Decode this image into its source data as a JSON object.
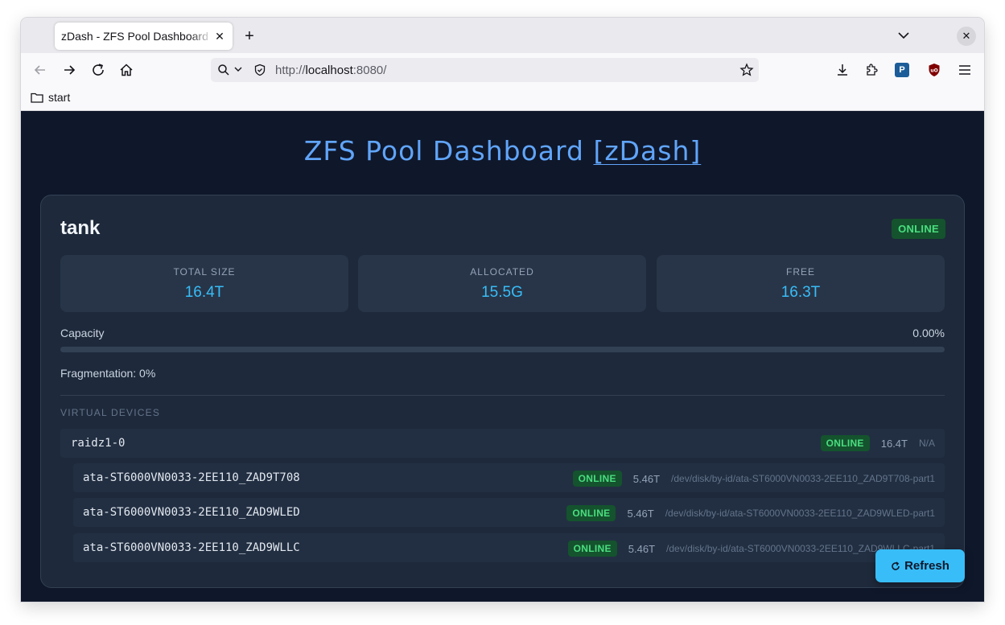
{
  "browser": {
    "tab_title": "zDash - ZFS Pool Dashboard",
    "url_scheme": "http://",
    "url_host": "localhost",
    "url_port": ":8080/",
    "bookmark": "start"
  },
  "page": {
    "title_main": "ZFS Pool Dashboard ",
    "title_link": "[zDash]"
  },
  "pool": {
    "name": "tank",
    "status": "ONLINE",
    "stats": [
      {
        "label": "TOTAL SIZE",
        "value": "16.4T"
      },
      {
        "label": "ALLOCATED",
        "value": "15.5G"
      },
      {
        "label": "FREE",
        "value": "16.3T"
      }
    ],
    "capacity_label": "Capacity",
    "capacity_value": "0.00%",
    "capacity_fraction": 0.0,
    "fragmentation": "Fragmentation: 0%",
    "vdevs_heading": "VIRTUAL DEVICES",
    "vdev": {
      "name": "raidz1-0",
      "status": "ONLINE",
      "size": "16.4T",
      "path": "N/A"
    },
    "disks": [
      {
        "name": "ata-ST6000VN0033-2EE110_ZAD9T708",
        "status": "ONLINE",
        "size": "5.46T",
        "path": "/dev/disk/by-id/ata-ST6000VN0033-2EE110_ZAD9T708-part1"
      },
      {
        "name": "ata-ST6000VN0033-2EE110_ZAD9WLED",
        "status": "ONLINE",
        "size": "5.46T",
        "path": "/dev/disk/by-id/ata-ST6000VN0033-2EE110_ZAD9WLED-part1"
      },
      {
        "name": "ata-ST6000VN0033-2EE110_ZAD9WLLC",
        "status": "ONLINE",
        "size": "5.46T",
        "path": "/dev/disk/by-id/ata-ST6000VN0033-2EE110_ZAD9WLLC-part1"
      }
    ]
  },
  "refresh_label": "Refresh",
  "icons": {
    "status_green": "#4ade80",
    "accent": "#38bdf8",
    "title_blue": "#60a5fa"
  }
}
